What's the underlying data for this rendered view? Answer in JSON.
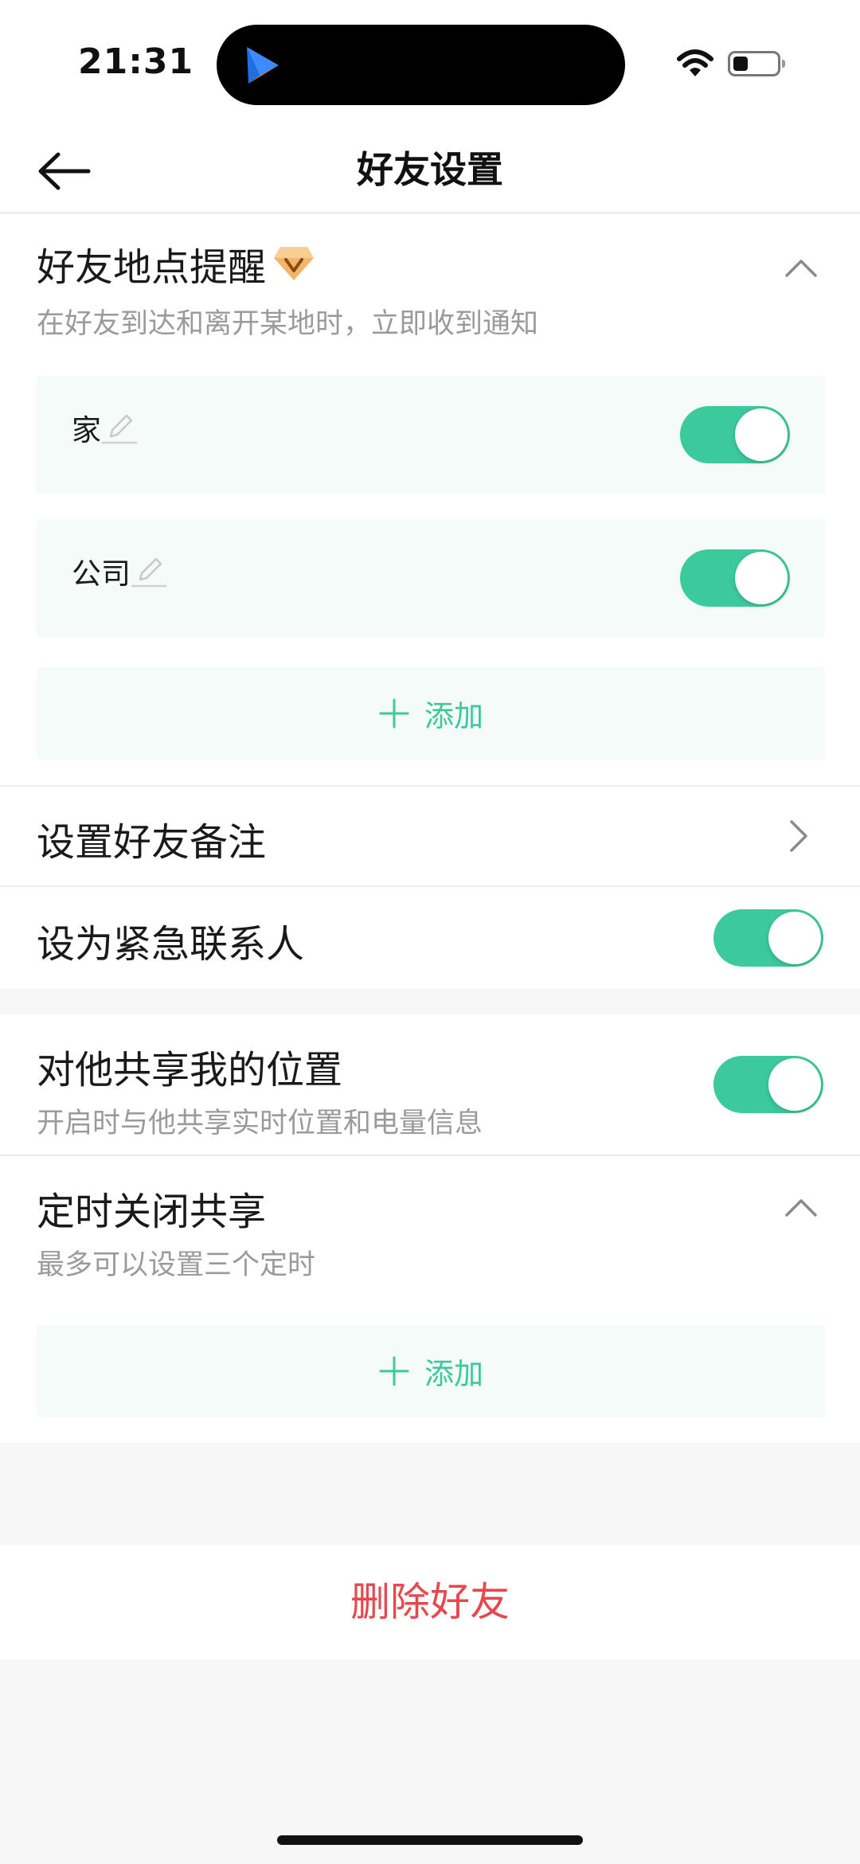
{
  "status_bar": {
    "time": "21:31",
    "battery_level": 0.35,
    "icons": [
      "app-logo-icon",
      "wifi-icon",
      "battery-icon"
    ]
  },
  "nav": {
    "title": "好友设置",
    "back_icon": "back-arrow-icon"
  },
  "location_alert": {
    "title": "好友地点提醒",
    "badge_icon": "vip-diamond-icon",
    "subtitle": "在好友到达和离开某地时，立即收到通知",
    "expanded": true,
    "places": [
      {
        "label": "家",
        "enabled": true
      },
      {
        "label": "公司",
        "enabled": true
      }
    ],
    "add_label": "添加"
  },
  "remark": {
    "title": "设置好友备注"
  },
  "emergency": {
    "title": "设为紧急联系人",
    "enabled": true
  },
  "share_location": {
    "title": "对他共享我的位置",
    "subtitle": "开启时与他共享实时位置和电量信息",
    "enabled": true
  },
  "timed_stop": {
    "title": "定时关闭共享",
    "subtitle": "最多可以设置三个定时",
    "expanded": true,
    "add_label": "添加"
  },
  "delete": {
    "label": "删除好友"
  },
  "colors": {
    "accent": "#3cc99c",
    "danger": "#e5484d",
    "item_bg": "#f4fbf8",
    "subtitle": "#9a9a9a"
  }
}
